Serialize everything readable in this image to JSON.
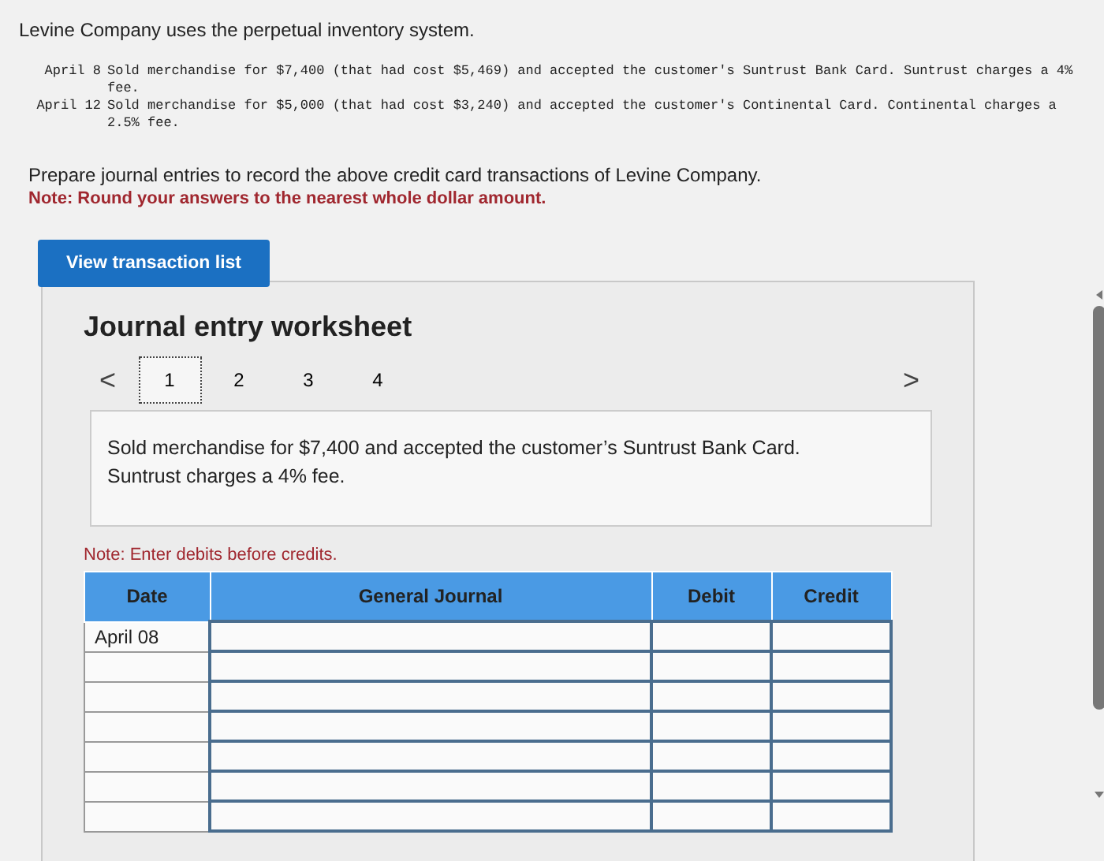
{
  "intro": "Levine Company uses the perpetual inventory system.",
  "transactions": [
    {
      "date": "April 8",
      "text": "Sold merchandise for $7,400 (that had cost $5,469) and accepted the customer's Suntrust Bank Card. Suntrust charges a 4% fee."
    },
    {
      "date": "April 12",
      "text": "Sold merchandise for $5,000 (that had cost $3,240) and accepted the customer's Continental Card. Continental charges a 2.5% fee."
    }
  ],
  "instructions": "Prepare journal entries to record the above credit card transactions of Levine Company.",
  "note": "Note: Round your answers to the nearest whole dollar amount.",
  "button": "View transaction list",
  "worksheet": {
    "title": "Journal entry worksheet",
    "prev": "<",
    "next": ">",
    "pages": [
      {
        "label": "1",
        "selected": true
      },
      {
        "label": "2",
        "selected": false
      },
      {
        "label": "3",
        "selected": false
      },
      {
        "label": "4",
        "selected": false
      }
    ],
    "description": "Sold merchandise for $7,400 and accepted the customer’s Suntrust Bank Card. Suntrust charges a 4% fee.",
    "table_note": "Note: Enter debits before credits.",
    "columns": [
      "Date",
      "General Journal",
      "Debit",
      "Credit"
    ],
    "rows": [
      {
        "date": "April 08"
      },
      {},
      {},
      {},
      {},
      {},
      {}
    ]
  }
}
